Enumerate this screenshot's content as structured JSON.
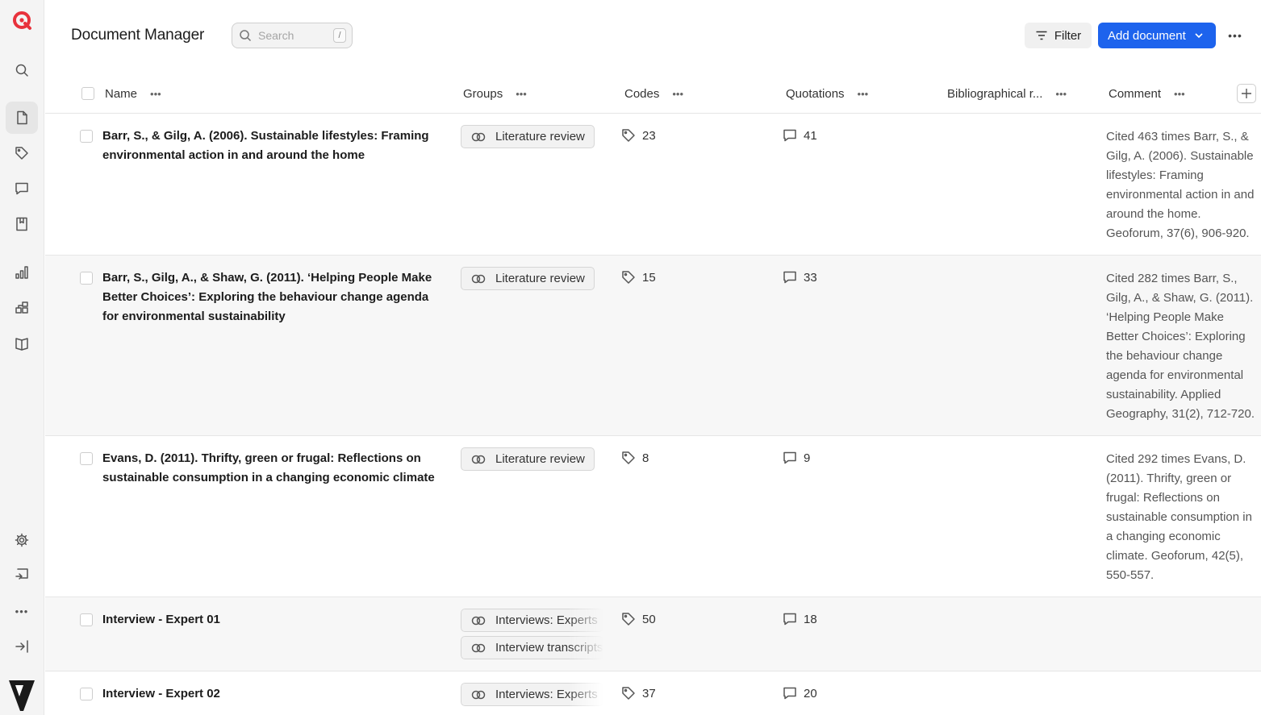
{
  "header": {
    "title": "Document Manager",
    "search_placeholder": "Search",
    "search_shortcut": "/",
    "filter_label": "Filter",
    "add_label": "Add document"
  },
  "columns": {
    "name": "Name",
    "groups": "Groups",
    "codes": "Codes",
    "quotations": "Quotations",
    "bibliographical": "Bibliographical r...",
    "comment": "Comment"
  },
  "sidebar": {
    "icons": [
      "search-icon",
      "document-icon",
      "tag-icon",
      "comment-icon",
      "memo-icon",
      "chart-icon",
      "network-icon",
      "book-icon",
      "gear-icon",
      "import-icon",
      "more-icon",
      "collapse-icon"
    ]
  },
  "rows": [
    {
      "name": "Barr, S., & Gilg, A. (2006). Sustainable lifestyles: Framing environmental action in and around the home",
      "groups": [
        "Literature review"
      ],
      "codes": "23",
      "quotations": "41",
      "comment": "Cited 463 times Barr, S., & Gilg, A. (2006). Sustainable lifestyles: Framing environmental action in and around the home. Geoforum, 37(6), 906-920."
    },
    {
      "name": "Barr, S., Gilg, A., & Shaw, G. (2011). ‘Helping People Make Better Choices’: Exploring the behaviour change agenda for environmental sustainability",
      "groups": [
        "Literature review"
      ],
      "codes": "15",
      "quotations": "33",
      "comment": "Cited 282 times Barr, S., Gilg, A., & Shaw, G. (2011). ‘Helping People Make Better Choices’: Exploring the behaviour change agenda for environmental sustainability. Applied Geography, 31(2), 712-720."
    },
    {
      "name": "Evans, D. (2011). Thrifty, green or frugal: Reflections on sustainable consumption in a changing economic climate",
      "groups": [
        "Literature review"
      ],
      "codes": "8",
      "quotations": "9",
      "comment": "Cited 292 times Evans, D. (2011). Thrifty, green or frugal: Reflections on sustainable consumption in a changing economic climate. Geoforum, 42(5), 550-557."
    },
    {
      "name": "Interview - Expert 01",
      "groups": [
        "Interviews: Experts",
        "Interview transcripts"
      ],
      "codes": "50",
      "quotations": "18",
      "comment": ""
    },
    {
      "name": "Interview - Expert 02",
      "groups": [
        "Interviews: Experts"
      ],
      "codes": "37",
      "quotations": "20",
      "comment": ""
    }
  ],
  "colors": {
    "accent": "#1d63ed",
    "brand": "#e8323c"
  }
}
